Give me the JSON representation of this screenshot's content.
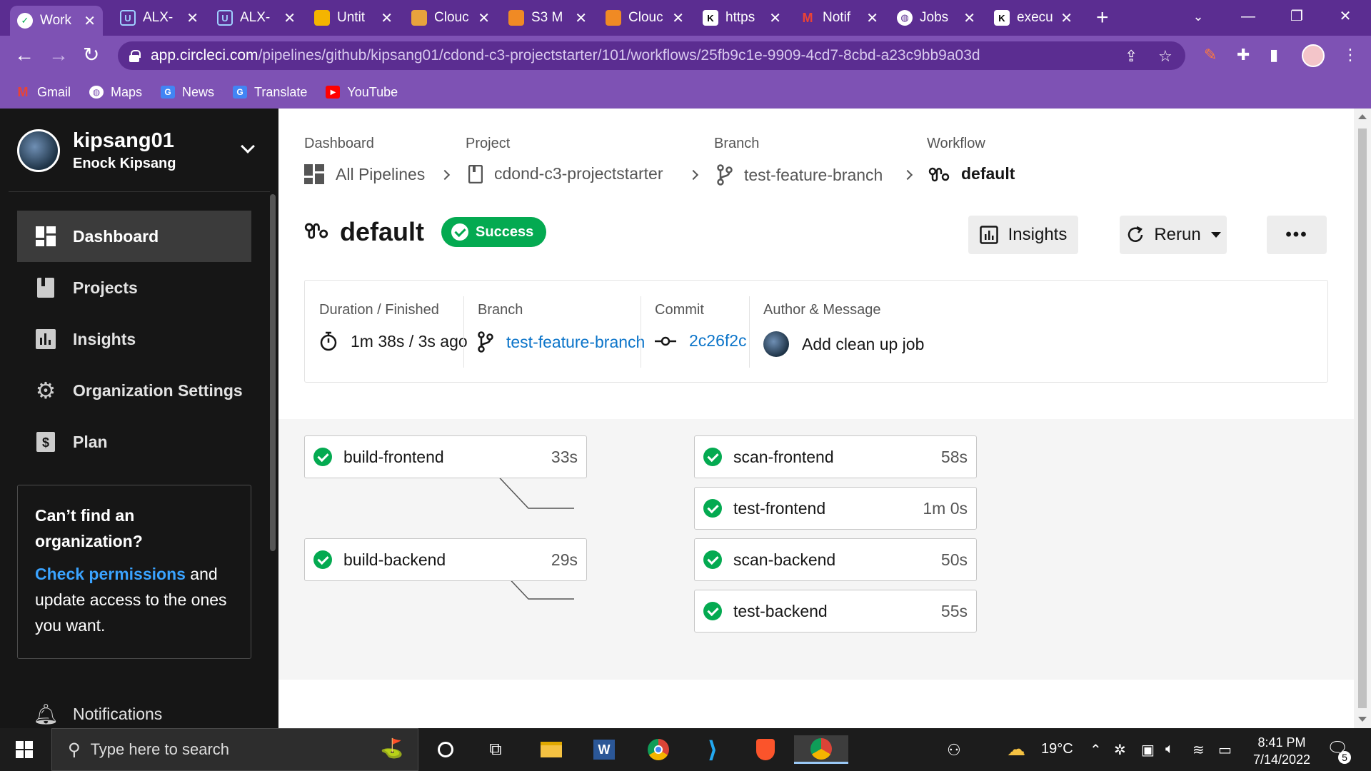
{
  "browser": {
    "tabs": [
      {
        "title": "Work",
        "icon": "circleci-icon",
        "active": true
      },
      {
        "title": "ALX-",
        "icon": "alx-icon"
      },
      {
        "title": "ALX-",
        "icon": "alx-icon"
      },
      {
        "title": "Untit",
        "icon": "slides-icon"
      },
      {
        "title": "Clouc",
        "icon": "aws-box-icon"
      },
      {
        "title": "S3 M",
        "icon": "aws-cube-icon"
      },
      {
        "title": "Clouc",
        "icon": "aws-cube-icon"
      },
      {
        "title": "https",
        "icon": "kv-icon"
      },
      {
        "title": "Notif",
        "icon": "gmail-icon"
      },
      {
        "title": "Jobs",
        "icon": "globe-icon"
      },
      {
        "title": "execu",
        "icon": "kv-icon"
      }
    ],
    "new_tab_glyph": "+",
    "url_host": "app.circleci.com",
    "url_path": "/pipelines/github/kipsang01/cdond-c3-projectstarter/101/workflows/25fb9c1e-9909-4cd7-8cbd-a23c9bb9a03d",
    "bookmarks": [
      {
        "label": "Gmail",
        "icon": "gmail-icon",
        "color": "#ea4335"
      },
      {
        "label": "Maps",
        "icon": "globe-icon",
        "color": "#ffffff"
      },
      {
        "label": "News",
        "icon": "news-icon",
        "color": "#4285f4"
      },
      {
        "label": "Translate",
        "icon": "translate-icon",
        "color": "#4285f4"
      },
      {
        "label": "YouTube",
        "icon": "youtube-icon",
        "color": "#ff0000"
      }
    ]
  },
  "sidebar": {
    "user_login": "kipsang01",
    "user_fullname": "Enock Kipsang",
    "nav": [
      {
        "label": "Dashboard",
        "icon": "dashboard-icon",
        "active": true
      },
      {
        "label": "Projects",
        "icon": "book-icon"
      },
      {
        "label": "Insights",
        "icon": "bar-chart-icon"
      },
      {
        "label": "Organization Settings",
        "icon": "gear-icon"
      },
      {
        "label": "Plan",
        "icon": "dollar-icon"
      }
    ],
    "org_box": {
      "title": "Can’t find an organization?",
      "link": "Check permissions",
      "body": " and update access to the ones you want."
    },
    "notifications": "Notifications"
  },
  "breadcrumb": {
    "dashboard_label": "Dashboard",
    "dashboard_value": "All Pipelines",
    "project_label": "Project",
    "project_value": "cdond-c3-projectstarter",
    "branch_label": "Branch",
    "branch_value": "test-feature-branch",
    "workflow_label": "Workflow",
    "workflow_value": "default"
  },
  "workflow": {
    "title": "default",
    "status": "Success",
    "status_color": "#04aa51",
    "insights_label": "Insights",
    "rerun_label": "Rerun",
    "more_label": "•••"
  },
  "meta": {
    "duration_label": "Duration / Finished",
    "duration_value": "1m 38s / 3s ago",
    "branch_label": "Branch",
    "branch_value": "test-feature-branch",
    "commit_label": "Commit",
    "commit_value": "2c26f2c",
    "author_label": "Author & Message",
    "author_message": "Add clean up job",
    "link_color": "#0b74c9"
  },
  "jobs": [
    {
      "name": "build-frontend",
      "duration": "33s"
    },
    {
      "name": "scan-frontend",
      "duration": "58s"
    },
    {
      "name": "test-frontend",
      "duration": "1m 0s"
    },
    {
      "name": "build-backend",
      "duration": "29s"
    },
    {
      "name": "scan-backend",
      "duration": "50s"
    },
    {
      "name": "test-backend",
      "duration": "55s"
    }
  ],
  "taskbar": {
    "search_placeholder": "Type here to search",
    "weather": "19°C",
    "time": "8:41 PM",
    "date": "7/14/2022",
    "notification_count": "5"
  }
}
